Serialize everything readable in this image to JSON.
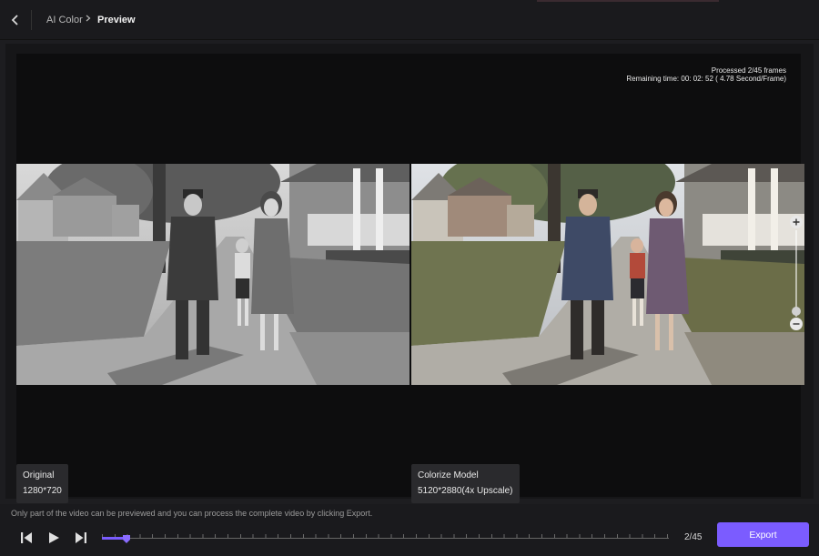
{
  "header": {
    "breadcrumb": [
      "AI Color",
      "Preview"
    ],
    "back_icon": "chevron-left-icon",
    "separator_icon": "chevron-right-icon"
  },
  "preview": {
    "status_line1": "Processed 2/45 frames",
    "status_line2": "Remaining time: 00: 02: 52 ( 4.78 Second/Frame)",
    "left": {
      "title": "Original",
      "resolution": "1280*720"
    },
    "right": {
      "title": "Colorize Model",
      "resolution": "5120*2880(4x Upscale)"
    },
    "zoom": {
      "plus_icon": "zoom-in-icon",
      "minus_icon": "zoom-out-icon",
      "level": 0.1
    }
  },
  "player": {
    "notice": "Only part of the video can be previewed and you can process the complete video by clicking Export.",
    "frame_counter": "2/45",
    "progress": 0.0222,
    "export_label": "Export",
    "icons": [
      "previous-frame-icon",
      "play-icon",
      "next-frame-icon"
    ]
  },
  "colors": {
    "accent": "#7b5cff",
    "background": "#1d1d20"
  }
}
